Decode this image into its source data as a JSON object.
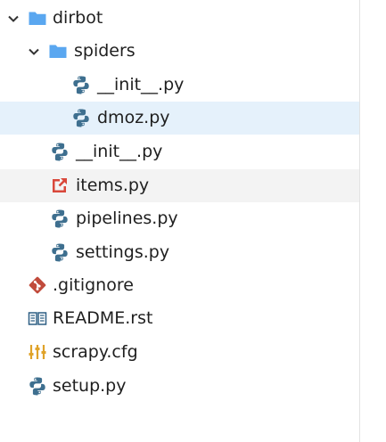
{
  "tree": {
    "root": {
      "label": "dirbot",
      "icon": "folder-icon",
      "state": "expanded"
    },
    "spiders": {
      "label": "spiders",
      "icon": "folder-icon",
      "state": "expanded"
    },
    "spiders_init": {
      "label": "__init__.py",
      "icon": "python-file-icon"
    },
    "dmoz": {
      "label": "dmoz.py",
      "icon": "python-file-icon",
      "selected": true
    },
    "dirbot_init": {
      "label": "__init__.py",
      "icon": "python-file-icon"
    },
    "items": {
      "label": "items.py",
      "icon": "external-link-file-icon",
      "hovered": true
    },
    "pipelines": {
      "label": "pipelines.py",
      "icon": "python-file-icon"
    },
    "settings": {
      "label": "settings.py",
      "icon": "python-file-icon"
    },
    "gitignore": {
      "label": ".gitignore",
      "icon": "git-icon"
    },
    "readme": {
      "label": "README.rst",
      "icon": "book-icon"
    },
    "scrapy_cfg": {
      "label": "scrapy.cfg",
      "icon": "config-sliders-icon"
    },
    "setup": {
      "label": "setup.py",
      "icon": "python-file-icon"
    }
  },
  "colors": {
    "folder": "#5aa7f0",
    "python": "#3e6f8f",
    "git": "#c14b3c",
    "items_icon": "#d9483b",
    "config": "#e0a32a",
    "selection": "#e5f1fb",
    "hover": "#f3f3f3"
  }
}
